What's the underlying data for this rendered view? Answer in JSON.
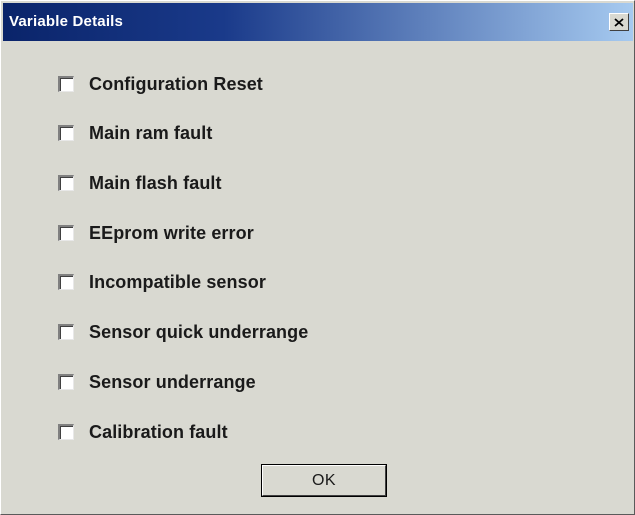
{
  "window": {
    "title": "Variable Details",
    "close_symbol": "×"
  },
  "options": [
    {
      "label": "Configuration Reset",
      "checked": false
    },
    {
      "label": "Main ram fault",
      "checked": false
    },
    {
      "label": "Main flash fault",
      "checked": false
    },
    {
      "label": "EEprom write error",
      "checked": false
    },
    {
      "label": "Incompatible sensor",
      "checked": false
    },
    {
      "label": "Sensor quick underrange",
      "checked": false
    },
    {
      "label": "Sensor underrange",
      "checked": false
    },
    {
      "label": "Calibration fault",
      "checked": false
    }
  ],
  "buttons": {
    "ok_label": "OK"
  },
  "colors": {
    "titlebar_start": "#0a246a",
    "titlebar_end": "#a6caf0",
    "window_bg": "#d9d9d1"
  }
}
